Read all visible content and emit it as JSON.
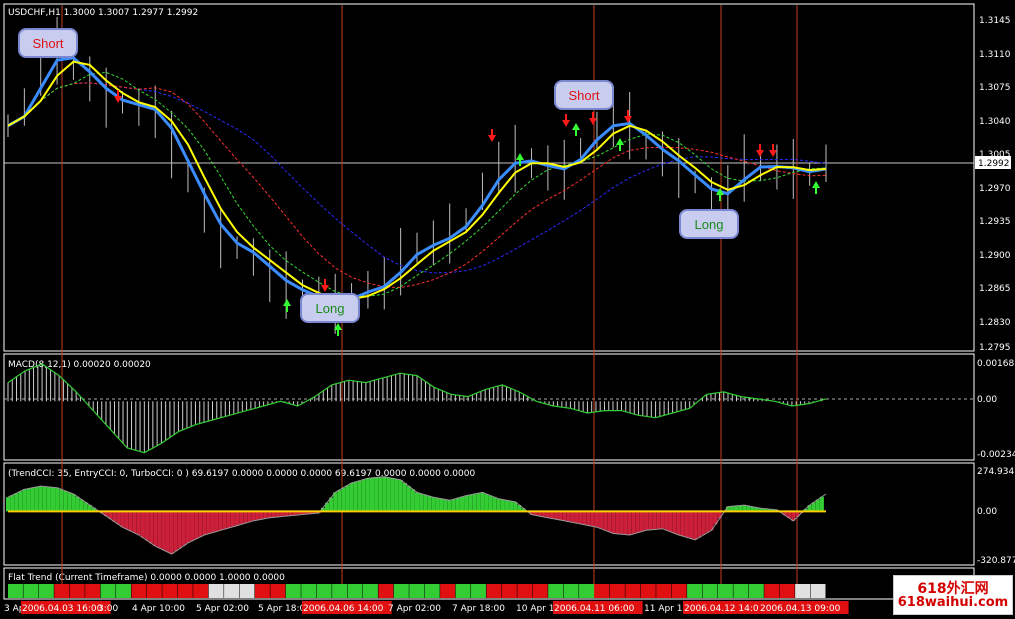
{
  "chart_data": {
    "type": "line",
    "price_panel": {
      "header": "USDCHF,H1  1.3000 1.3007 1.2977 1.2992",
      "y_ticks": [
        "1.3145",
        "1.3110",
        "1.3075",
        "1.3040",
        "1.3005",
        "1.2970",
        "1.2935",
        "1.2900",
        "1.2865",
        "1.2830",
        "1.2795"
      ],
      "ylim": [
        1.2795,
        1.3145
      ],
      "current_price": "1.2992",
      "close_series": [
        1.303,
        1.305,
        1.309,
        1.311,
        1.3095,
        1.308,
        1.306,
        1.3055,
        1.305,
        1.3045,
        1.301,
        1.2975,
        1.294,
        1.291,
        1.29,
        1.289,
        1.287,
        1.286,
        1.285,
        1.2845,
        1.284,
        1.285,
        1.2855,
        1.2862,
        1.2885,
        1.29,
        1.2905,
        1.2915,
        1.293,
        1.296,
        1.2985,
        1.2995,
        1.299,
        1.2985,
        1.2983,
        1.3005,
        1.3025,
        1.3035,
        1.303,
        1.301,
        1.3,
        1.2985,
        1.297,
        1.2955,
        1.296,
        1.2985,
        1.2987,
        1.2986,
        1.2984,
        1.2978,
        1.299
      ],
      "signals": [
        {
          "label": "Short",
          "type": "short"
        },
        {
          "label": "Long",
          "type": "long"
        },
        {
          "label": "Short",
          "type": "short"
        },
        {
          "label": "Long",
          "type": "long"
        }
      ]
    },
    "macd_panel": {
      "header": "MACD(8,12,1) 0.00020 0.00020",
      "y_ticks": [
        "0.00168",
        "0.00",
        "-0.00234"
      ],
      "ylim": [
        -0.00234,
        0.00168
      ],
      "values": [
        0.0008,
        0.0013,
        0.0016,
        0.0011,
        0.0004,
        -0.0004,
        -0.0012,
        -0.002,
        -0.0022,
        -0.0018,
        -0.0013,
        -0.001,
        -0.0008,
        -0.0006,
        -0.0004,
        -0.0002,
        0.0,
        -0.0002,
        0.0002,
        0.0007,
        0.0009,
        0.0008,
        0.001,
        0.0012,
        0.0011,
        0.0006,
        0.0003,
        0.0002,
        0.0005,
        0.0007,
        0.0004,
        0.0,
        -0.0002,
        -0.0003,
        -0.0005,
        -0.0004,
        -0.0004,
        -0.0006,
        -0.0007,
        -0.0005,
        -0.0003,
        0.0003,
        0.0004,
        0.0002,
        0.0001,
        0.0,
        -0.0002,
        -0.0001,
        0.0001
      ]
    },
    "cci_panel": {
      "header": "(TrendCCI: 35, EntryCCI: 0, TurboCCI: 0 )  69.6197 0.0000 0.0000 0.0000 69.6197 0.0000 0.0000 0.0000",
      "y_ticks": [
        "274.9347",
        "0.00",
        "-320.8779"
      ],
      "ylim": [
        -320.8779,
        274.9347
      ],
      "values": [
        90,
        140,
        160,
        150,
        110,
        40,
        -30,
        -100,
        -150,
        -220,
        -270,
        -200,
        -150,
        -120,
        -90,
        -60,
        -40,
        -30,
        -20,
        -10,
        120,
        180,
        210,
        220,
        200,
        120,
        90,
        70,
        100,
        120,
        80,
        60,
        -20,
        -40,
        -60,
        -80,
        -100,
        -140,
        -150,
        -120,
        -110,
        -150,
        -180,
        -120,
        30,
        40,
        20,
        10,
        -60,
        40,
        110
      ]
    },
    "flat_panel": {
      "header": "Flat Trend (Current Timeframe) 0.0000 0.0000 1.0000 0.0000",
      "blocks": [
        "g",
        "g",
        "g",
        "r",
        "r",
        "r",
        "g",
        "g",
        "r",
        "r",
        "r",
        "r",
        "r",
        "w",
        "w",
        "w",
        "r",
        "r",
        "g",
        "g",
        "g",
        "g",
        "g",
        "g",
        "r",
        "g",
        "g",
        "g",
        "r",
        "g",
        "g",
        "r",
        "r",
        "r",
        "r",
        "g",
        "g",
        "g",
        "r",
        "r",
        "r",
        "r",
        "r",
        "r",
        "g",
        "g",
        "g",
        "g",
        "g",
        "r",
        "r",
        "w",
        "w"
      ]
    },
    "x_ticks": [
      "3 Ap",
      "2006.04.03 16:00",
      "3:00",
      "4 Apr 10:00",
      "5 Apr 02:00",
      "5 Apr 18:0",
      "2006.04.06 14:00",
      "7 Apr 02:00",
      "7 Apr 18:00",
      "10 Apr 1",
      "2006.04.11 06:00",
      "11 Apr 19",
      "2006.04.12 14:00",
      "2006.04.13 09:00"
    ]
  },
  "colors": {
    "price_line": "#ffff00",
    "fast_line": "#3a8cff",
    "band_outer": "#2a2aff",
    "band_red": "#ff3030",
    "band_green": "#33dd33",
    "macd": "#33cc33",
    "cci_up": "#33cc33",
    "cci_down": "#cc1f3a",
    "cci_turbo": "#ffd000",
    "session_line": "#c04020",
    "grid": "#ffffff"
  },
  "watermark": {
    "line1": "618外汇网",
    "line2": "618waihui.com"
  }
}
